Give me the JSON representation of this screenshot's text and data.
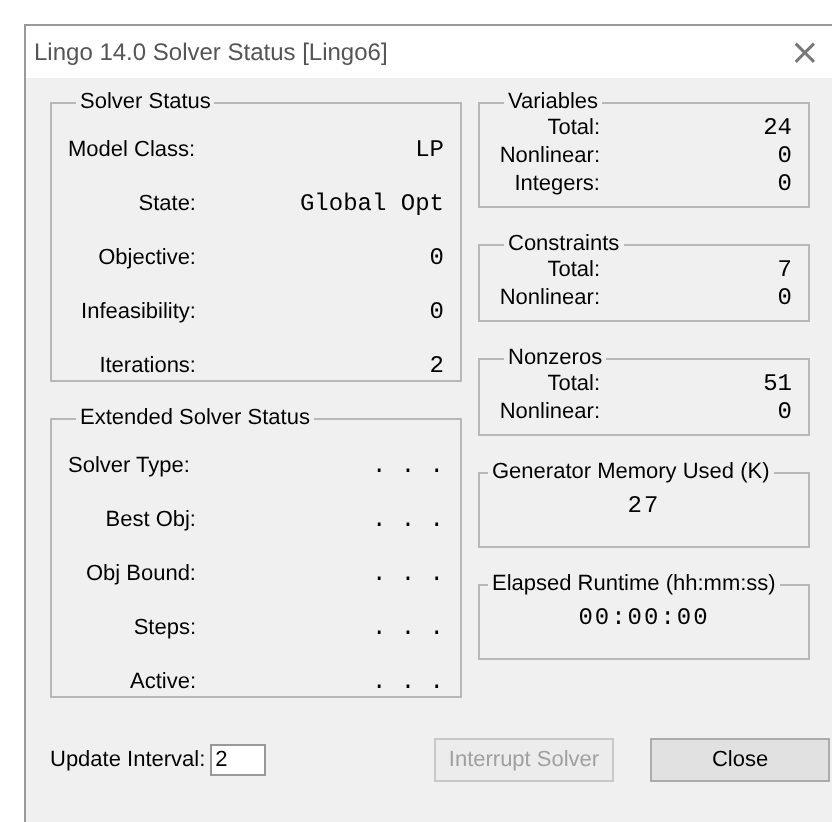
{
  "window": {
    "title": "Lingo 14.0 Solver Status [Lingo6]",
    "close": "×"
  },
  "left_groups": [
    {
      "title": "Solver Status",
      "rows": [
        {
          "label": "Model Class:",
          "value": "LP"
        },
        {
          "label": "State:",
          "value": "Global Opt"
        },
        {
          "label": "Objective:",
          "value": "0"
        },
        {
          "label": "Infeasibility:",
          "value": "0"
        },
        {
          "label": "Iterations:",
          "value": "2"
        }
      ]
    },
    {
      "title": "Extended Solver Status",
      "rows": [
        {
          "label": "Solver Type:",
          "value": ". . ."
        },
        {
          "label": "Best Obj:",
          "value": ". . ."
        },
        {
          "label": "Obj Bound:",
          "value": ". . ."
        },
        {
          "label": "Steps:",
          "value": ". . ."
        },
        {
          "label": "Active:",
          "value": ". . ."
        }
      ]
    }
  ],
  "right_groups": [
    {
      "kind": "table",
      "title": "Variables",
      "rows": [
        {
          "label": "Total:",
          "value": "24"
        },
        {
          "label": "Nonlinear:",
          "value": "0"
        },
        {
          "label": "Integers:",
          "value": "0"
        }
      ]
    },
    {
      "kind": "table",
      "title": "Constraints",
      "rows": [
        {
          "label": "Total:",
          "value": "7"
        },
        {
          "label": "Nonlinear:",
          "value": "0"
        }
      ]
    },
    {
      "kind": "table",
      "title": "Nonzeros",
      "rows": [
        {
          "label": "Total:",
          "value": "51"
        },
        {
          "label": "Nonlinear:",
          "value": "0"
        }
      ]
    },
    {
      "kind": "single",
      "title": "Generator Memory Used (K)",
      "value": "27"
    },
    {
      "kind": "single",
      "title": "Elapsed Runtime (hh:mm:ss)",
      "value": "00:00:00"
    }
  ],
  "update_interval": {
    "label": "Update Interval:",
    "value": "2"
  },
  "buttons": [
    {
      "label": "Interrupt Solver",
      "disabled": true
    },
    {
      "label": "Close",
      "disabled": false
    }
  ]
}
